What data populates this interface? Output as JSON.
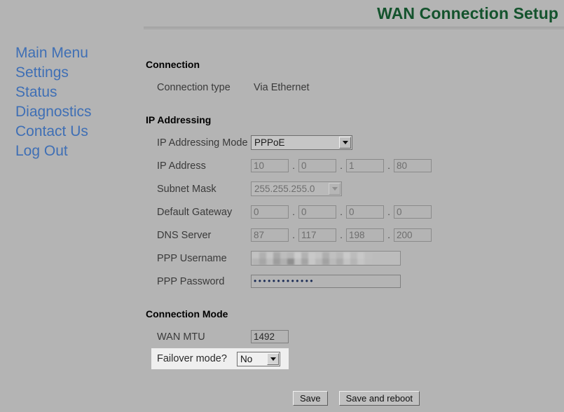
{
  "header": {
    "title": "WAN Connection Setup"
  },
  "sidebar": {
    "items": [
      {
        "label": "Main Menu",
        "name": "main-menu"
      },
      {
        "label": "Settings",
        "name": "settings"
      },
      {
        "label": "Status",
        "name": "status"
      },
      {
        "label": "Diagnostics",
        "name": "diagnostics"
      },
      {
        "label": "Contact Us",
        "name": "contact-us"
      },
      {
        "label": "Log Out",
        "name": "log-out"
      }
    ]
  },
  "connection": {
    "heading": "Connection",
    "type_label": "Connection type",
    "type_value": "Via Ethernet"
  },
  "ip_addressing": {
    "heading": "IP Addressing",
    "mode_label": "IP Addressing Mode",
    "mode_value": "PPPoE",
    "ip_label": "IP Address",
    "ip_octets": [
      "10",
      "0",
      "1",
      "80"
    ],
    "subnet_label": "Subnet Mask",
    "subnet_value": "255.255.255.0",
    "gateway_label": "Default Gateway",
    "gateway_octets": [
      "0",
      "0",
      "0",
      "0"
    ],
    "dns_label": "DNS Server",
    "dns_octets": [
      "87",
      "117",
      "198",
      "200"
    ],
    "ppp_username_label": "PPP Username",
    "ppp_username_value": "",
    "ppp_password_label": "PPP Password",
    "ppp_password_value": "•••••••••••••",
    "separator": "."
  },
  "connection_mode": {
    "heading": "Connection Mode",
    "mtu_label": "WAN MTU",
    "mtu_value": "1492",
    "failover_label": "Failover mode?",
    "failover_value": "No"
  },
  "actions": {
    "save_label": "Save",
    "save_reboot_label": "Save and reboot"
  },
  "colors": {
    "page_background": "#b4b4b4",
    "title_green": "#14532d",
    "link_blue": "#3f6fb5",
    "highlight": "#efefef"
  }
}
